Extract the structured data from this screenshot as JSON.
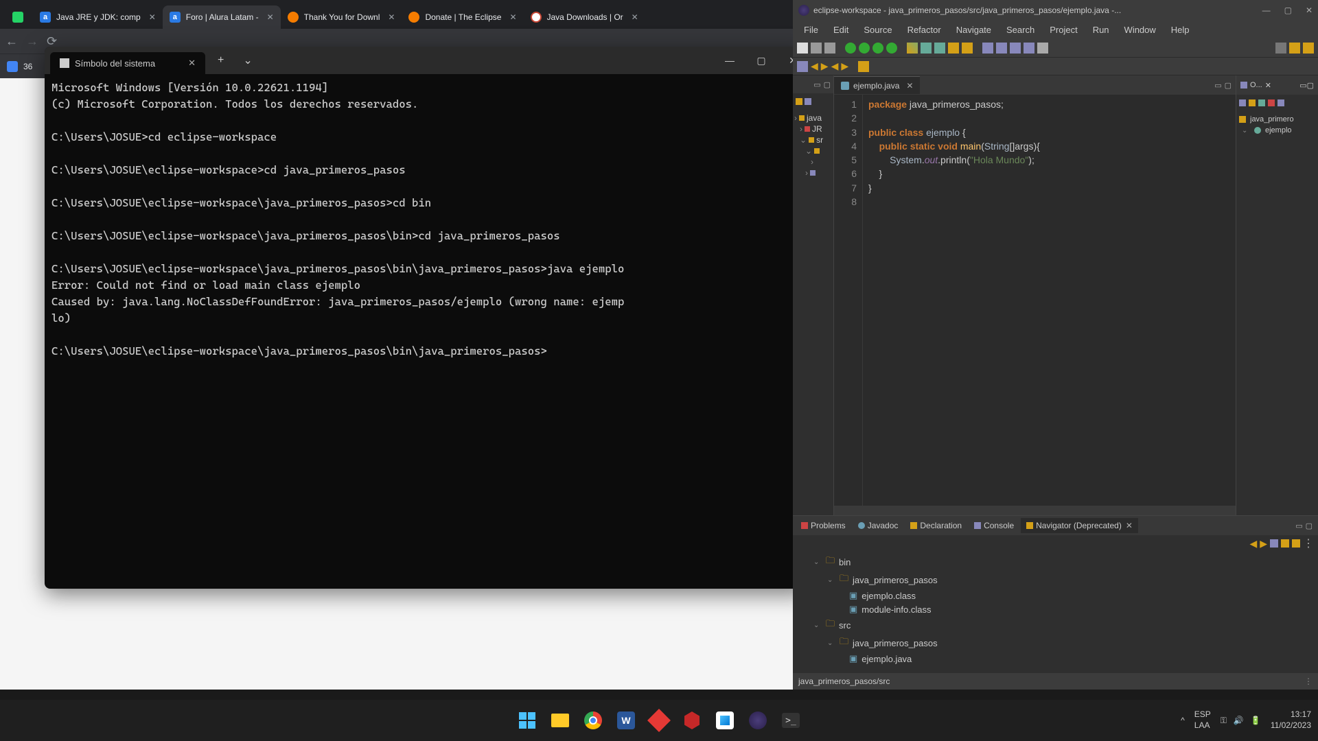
{
  "browser": {
    "tabs": [
      {
        "label": "",
        "icon": "wa"
      },
      {
        "label": "Java JRE y JDK: comp",
        "icon": "alura"
      },
      {
        "label": "Foro | Alura Latam -",
        "icon": "alura",
        "active": true
      },
      {
        "label": "Thank You for Downl",
        "icon": "ef"
      },
      {
        "label": "Donate | The Eclipse",
        "icon": "ef"
      },
      {
        "label": "Java Downloads | Or",
        "icon": "oracle"
      }
    ],
    "bookmark": "36"
  },
  "terminal": {
    "tab_label": "Símbolo del sistema",
    "lines": [
      "Microsoft Windows [Versión 10.0.22621.1194]",
      "(c) Microsoft Corporation. Todos los derechos reservados.",
      "",
      "C:\\Users\\JOSUE>cd eclipse-workspace",
      "",
      "C:\\Users\\JOSUE\\eclipse-workspace>cd java_primeros_pasos",
      "",
      "C:\\Users\\JOSUE\\eclipse-workspace\\java_primeros_pasos>cd bin",
      "",
      "C:\\Users\\JOSUE\\eclipse-workspace\\java_primeros_pasos\\bin>cd java_primeros_pasos",
      "",
      "C:\\Users\\JOSUE\\eclipse-workspace\\java_primeros_pasos\\bin\\java_primeros_pasos>java ejemplo",
      "Error: Could not find or load main class ejemplo",
      "Caused by: java.lang.NoClassDefFoundError: java_primeros_pasos/ejemplo (wrong name: ejemp",
      "lo)",
      "",
      "C:\\Users\\JOSUE\\eclipse-workspace\\java_primeros_pasos\\bin\\java_primeros_pasos>"
    ]
  },
  "eclipse": {
    "title": "eclipse-workspace - java_primeros_pasos/src/java_primeros_pasos/ejemplo.java -...",
    "menu": [
      "File",
      "Edit",
      "Source",
      "Refactor",
      "Navigate",
      "Search",
      "Project",
      "Run",
      "Window",
      "Help"
    ],
    "editor_tab": "ejemplo.java",
    "pe_items": [
      "java",
      "JR",
      "sr",
      ""
    ],
    "code": {
      "l1_pkg": "package",
      "l1_name": " java_primeros_pasos;",
      "l3_pub": "public ",
      "l3_class": "class ",
      "l3_name": "ejemplo",
      "l3_brace": " {",
      "l4_ind": "    ",
      "l4_pub": "public ",
      "l4_stat": "static ",
      "l4_void": "void ",
      "l4_main": "main",
      "l4_p1": "(",
      "l4_str": "String",
      "l4_p2": "[]args){",
      "l5_ind": "        ",
      "l5_sys": "System",
      "l5_dot1": ".",
      "l5_out": "out",
      "l5_dot2": ".println(",
      "l5_str": "\"Hola Mundo\"",
      "l5_end": ");",
      "l6": "    }",
      "l7": "}",
      "lines": [
        "1",
        "2",
        "3",
        "4",
        "5",
        "6",
        "7",
        "8"
      ]
    },
    "outline_tab": "O...",
    "outline": {
      "pkg": "java_primero",
      "cls": "ejemplo"
    },
    "bottom_tabs": {
      "problems": "Problems",
      "javadoc": "Javadoc",
      "declaration": "Declaration",
      "console": "Console",
      "navigator": "Navigator (Deprecated)"
    },
    "nav_tree": {
      "bin": "bin",
      "pkg1": "java_primeros_pasos",
      "f1": "ejemplo.class",
      "f2": "module-info.class",
      "src": "src",
      "pkg2": "java_primeros_pasos",
      "f3": "ejemplo.java"
    },
    "status": "java_primeros_pasos/src"
  },
  "taskbar": {
    "lang1": "ESP",
    "lang2": "LAA",
    "time": "13:17",
    "date": "11/02/2023"
  }
}
